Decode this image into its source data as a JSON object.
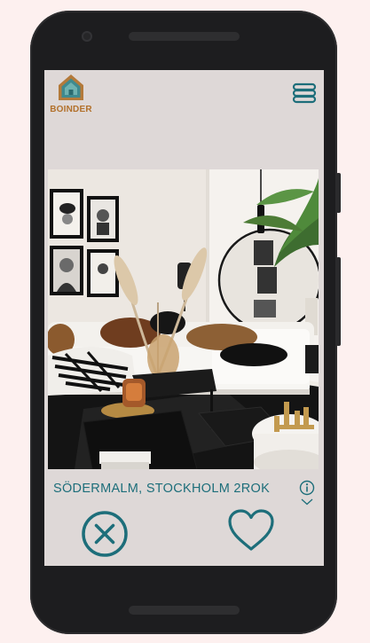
{
  "app": {
    "logo_text": "BOINDER"
  },
  "listing": {
    "caption": "SÖDERMALM, STOCKHOLM 2ROK",
    "photo_subject": "living-room-interior"
  },
  "icons": {
    "logo": "house-logo-icon",
    "menu": "hamburger-menu-icon",
    "info": "info-icon",
    "expand": "chevron-down-icon",
    "reject": "close-circle-icon",
    "like": "heart-icon"
  },
  "colors": {
    "accent": "#1d6e7a",
    "logo_text": "#b2702a",
    "logo_roof": "#b47a3a",
    "logo_fill": "#3f8a8f",
    "screen_bg": "#ded8d7",
    "page_bg": "#fdf0ef"
  }
}
